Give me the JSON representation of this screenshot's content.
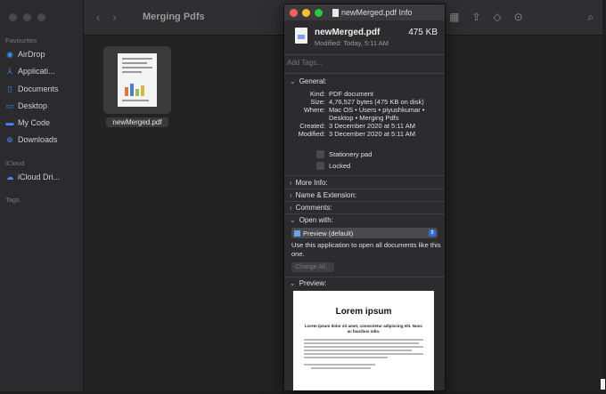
{
  "finder": {
    "title": "Merging Pdfs",
    "sidebar": {
      "favourites_label": "Favourites",
      "icloud_label": "iCloud",
      "tags_label": "Tags",
      "items": [
        {
          "label": "AirDrop",
          "icon": "airdrop-icon",
          "glyph": "◉"
        },
        {
          "label": "Applicati...",
          "icon": "applications-icon",
          "glyph": "⅄"
        },
        {
          "label": "Documents",
          "icon": "documents-icon",
          "glyph": "▯"
        },
        {
          "label": "Desktop",
          "icon": "desktop-icon",
          "glyph": "▭"
        },
        {
          "label": "My Code",
          "icon": "folder-icon",
          "glyph": "▬"
        },
        {
          "label": "Downloads",
          "icon": "downloads-icon",
          "glyph": "⊕"
        }
      ],
      "icloud_items": [
        {
          "label": "iCloud Dri...",
          "icon": "cloud-icon",
          "glyph": "☁"
        }
      ]
    },
    "file": {
      "name": "newMerged.pdf"
    }
  },
  "info": {
    "window_title": "newMerged.pdf Info",
    "name": "newMerged.pdf",
    "size": "475 KB",
    "modified_line": "Modified: Today, 5:11 AM",
    "tags_placeholder": "Add Tags...",
    "general_label": "General:",
    "kind_k": "Kind:",
    "kind_v": "PDF document",
    "size_k": "Size:",
    "size_v": "4,76,527 bytes (475 KB on disk)",
    "where_k": "Where:",
    "where_v1": "Mac OS • Users • piyushkumar •",
    "where_v2": "Desktop • Merging Pdfs",
    "created_k": "Created:",
    "created_v": "3 December 2020 at 5:11 AM",
    "modified_k": "Modified:",
    "modified_v": "3 December 2020 at 5:11 AM",
    "stationery_label": "Stationery pad",
    "locked_label": "Locked",
    "more_info_label": "More Info:",
    "name_ext_label": "Name & Extension:",
    "comments_label": "Comments:",
    "open_with_label": "Open with:",
    "open_with_value": "Preview (default)",
    "use_app_text": "Use this application to open all documents like this one.",
    "change_all_label": "Change All...",
    "preview_label": "Preview:",
    "preview_doc": {
      "title": "Lorem ipsum",
      "subtitle": "Lorem ipsum dolor sit amet, consectetur adipiscing elit. Nunc ac faucibus odio."
    }
  },
  "colors": {
    "close": "#fe5f57",
    "minimize": "#febc2e",
    "zoom": "#28c840",
    "accent": "#2f6ed8"
  }
}
